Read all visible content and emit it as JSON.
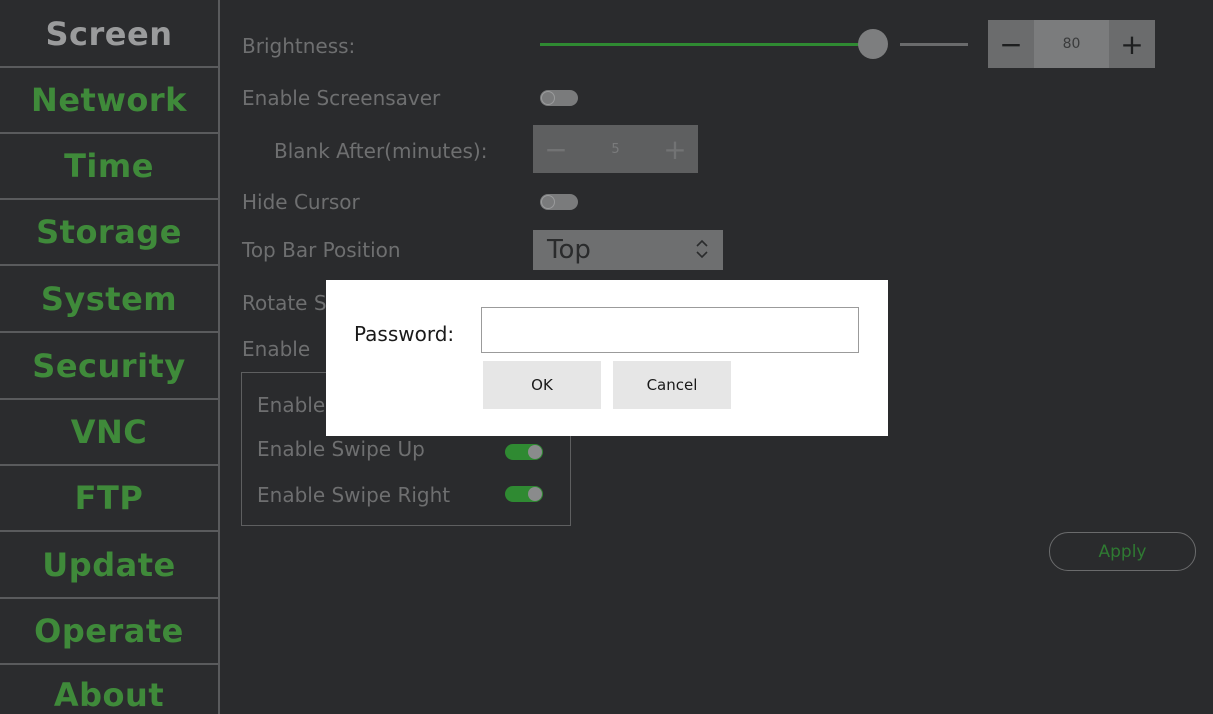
{
  "sidebar": {
    "items": [
      {
        "label": "Screen",
        "active": true
      },
      {
        "label": "Network"
      },
      {
        "label": "Time"
      },
      {
        "label": "Storage"
      },
      {
        "label": "System"
      },
      {
        "label": "Security"
      },
      {
        "label": "VNC"
      },
      {
        "label": "FTP"
      },
      {
        "label": "Update"
      },
      {
        "label": "Operate"
      },
      {
        "label": "About"
      }
    ]
  },
  "screen": {
    "brightness_label": "Brightness:",
    "brightness_value": "80",
    "brightness_level_percent": 80,
    "spin_minus": "−",
    "spin_plus": "+",
    "screensaver_label": "Enable Screensaver",
    "screensaver_on": false,
    "blank_after_label": "Blank After(minutes):",
    "blank_after_value": "5",
    "hide_cursor_label": "Hide Cursor",
    "hide_cursor_on": false,
    "top_bar_position_label": "Top Bar Position",
    "top_bar_position_value": "Top",
    "rotate_label_partial": "Rotate S",
    "enable_label_partial": "Enable",
    "group_enable_partial": "Enable",
    "swipe_up_label": "Enable Swipe Up",
    "swipe_up_on": true,
    "swipe_right_label": "Enable Swipe Right",
    "swipe_right_on": true,
    "apply_label": "Apply"
  },
  "dialog": {
    "password_label": "Password:",
    "password_value": "",
    "ok_label": "OK",
    "cancel_label": "Cancel"
  },
  "colors": {
    "accent_green": "#2f8a32",
    "nav_green": "#3f8a3a",
    "background": "#2a2b2d"
  }
}
